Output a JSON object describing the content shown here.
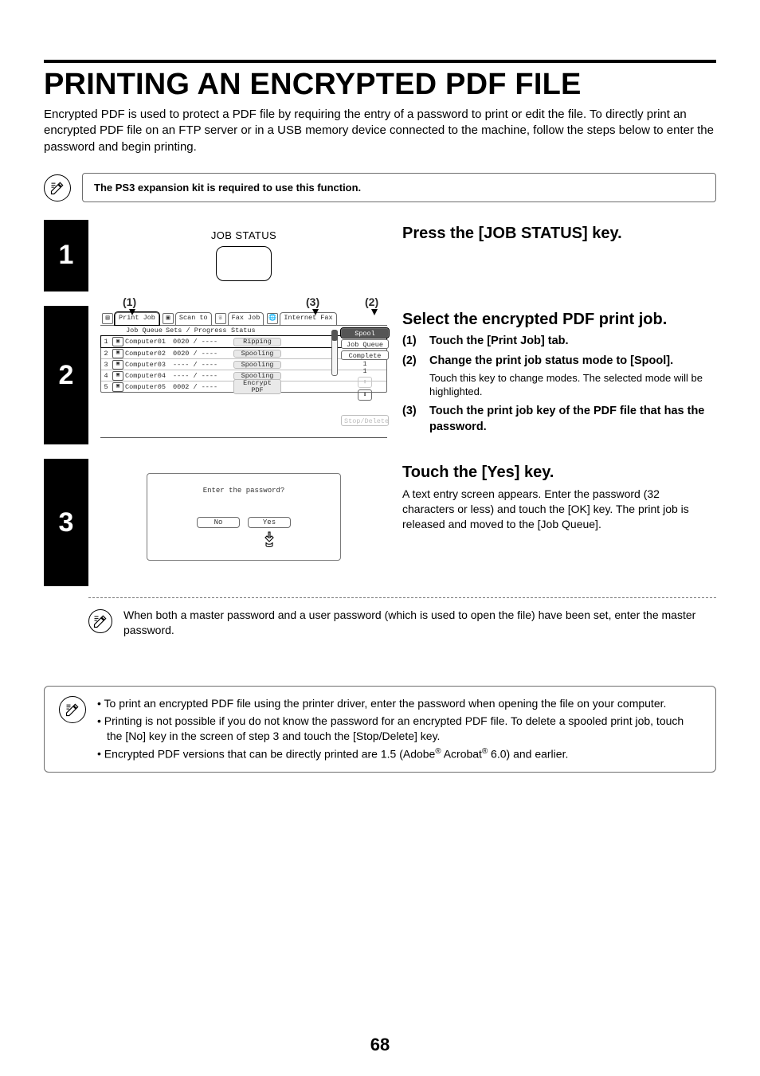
{
  "page_number": "68",
  "headline": "PRINTING AN ENCRYPTED PDF FILE",
  "intro": "Encrypted PDF is used to protect a PDF file by requiring the entry of a password to print or edit the file. To directly print an encrypted PDF file on an FTP server or in a USB memory device connected to the machine, follow the steps below to enter the password and begin printing.",
  "top_note": "The PS3 expansion kit is required to use this function.",
  "steps": {
    "s1": {
      "key_label": "JOB STATUS",
      "title": "Press the [JOB STATUS] key."
    },
    "s2": {
      "callouts": {
        "c1": "(1)",
        "c2": "(2)",
        "c3": "(3)"
      },
      "screen": {
        "tabs": [
          "Print Job",
          "Scan to",
          "Fax Job",
          "Internet Fax"
        ],
        "headers": [
          "Job Queue",
          "Sets / Progress",
          "Status"
        ],
        "rows": [
          {
            "n": "1",
            "name": "Computer01",
            "prog": "0020 / ----",
            "stat": "Ripping"
          },
          {
            "n": "2",
            "name": "Computer02",
            "prog": "0020 / ----",
            "stat": "Spooling"
          },
          {
            "n": "3",
            "name": "Computer03",
            "prog": "---- / ----",
            "stat": "Spooling"
          },
          {
            "n": "4",
            "name": "Computer04",
            "prog": "---- / ----",
            "stat": "Spooling"
          },
          {
            "n": "5",
            "name": "Computer05",
            "prog": "0002 / ----",
            "stat": "Encrypt PDF"
          }
        ],
        "side": {
          "spool": "Spool",
          "jobqueue": "Job Queue",
          "complete": "Complete",
          "count_current": "1",
          "count_total": "1",
          "up": "⬆",
          "down": "⬇",
          "stopdel": "Stop/Delete"
        }
      },
      "title": "Select the encrypted PDF print job.",
      "items": [
        {
          "marker": "(1)",
          "lead": "Touch the [Print Job] tab."
        },
        {
          "marker": "(2)",
          "lead": "Change the print job status mode to [Spool].",
          "sub": "Touch this key to change modes. The selected mode will be highlighted."
        },
        {
          "marker": "(3)",
          "lead": "Touch the print job key of the PDF file that has the password."
        }
      ]
    },
    "s3": {
      "dialog": {
        "msg": "Enter the password?",
        "no": "No",
        "yes": "Yes"
      },
      "title": "Touch the [Yes] key.",
      "body": "A text entry screen appears. Enter the password (32 characters or less) and touch the [OK] key. The print job is released and moved to the [Job Queue].",
      "inner_note": "When both a master password and a user password (which is used to open the file) have been set, enter the master password."
    }
  },
  "bottom_notes": {
    "b1": "To print an encrypted PDF file using the printer driver, enter the password when opening the file on your computer.",
    "b2": "Printing is not possible if you do not know the password for an encrypted PDF file. To delete a spooled print job, touch the [No] key in the screen of step 3 and touch the [Stop/Delete] key.",
    "b3_pre": "Encrypted PDF versions that can be directly printed are 1.5 (Adobe",
    "b3_mid": " Acrobat",
    "b3_post": " 6.0) and earlier."
  }
}
